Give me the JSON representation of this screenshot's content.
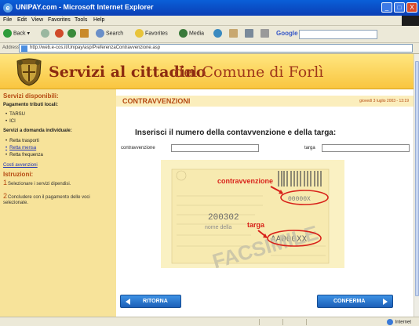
{
  "window": {
    "title": "UNIPAY.com - Microsoft Internet Explorer",
    "min": "_",
    "max": "□",
    "close": "X"
  },
  "menu": [
    "File",
    "Edit",
    "View",
    "Favorites",
    "Tools",
    "Help"
  ],
  "toolbar": {
    "back": "Back",
    "search": "Search",
    "favorites": "Favorites",
    "media": "Media",
    "google": "Google"
  },
  "address": {
    "label": "Address",
    "url": "http://web.e-cos.it/Unipay/asp/PreferenzaContravvenzione.asp"
  },
  "banner": {
    "title_bold": "Servizi al cittadino",
    "title_regular": "del Comune di Forlì"
  },
  "sidebar": {
    "services_heading": "Servizi disponibili:",
    "local_taxes": "Pagamento tributi locali:",
    "tax_items": [
      "TARSU",
      "ICI"
    ],
    "individual_services": "Servizi a domanda individuale:",
    "service_items": [
      "Retta trasporti",
      "Retta mensa",
      "Retta frequenza"
    ],
    "fines_link": "Costi avvenzioni",
    "instructions_heading": "Istruzioni:",
    "steps": [
      {
        "num": "1",
        "text": "Selezionare i servizi dipendisi."
      },
      {
        "num": "2",
        "text": "Concludere con il pagamento delle voci selezionate."
      }
    ]
  },
  "main": {
    "heading": "CONTRAVVENZIONI",
    "date": "giovedì 3 luglio 2003 - 13:19",
    "prompt": "Inserisci il numero della contavvenzione e della targa:",
    "fine_label": "contravvenzione",
    "plate_label": "targa",
    "facsimile": {
      "label_fine": "contravvenzione",
      "label_plate": "targa",
      "number": "200302",
      "code": "00000X",
      "plate": "AA000XX",
      "stamp": "FACSIMILE",
      "name_line": "nome della"
    },
    "back_button": "RITORNA",
    "confirm_button": "CONFERMA"
  },
  "status": {
    "zone": "Internet"
  }
}
